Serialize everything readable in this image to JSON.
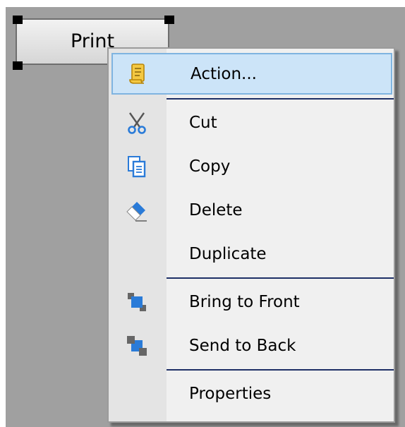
{
  "button": {
    "label": "Print"
  },
  "context_menu": {
    "items": [
      {
        "label": "Action...",
        "icon": "action-icon",
        "highlighted": true
      },
      {
        "label": "Cut",
        "icon": "scissors-icon"
      },
      {
        "label": "Copy",
        "icon": "copy-icon"
      },
      {
        "label": "Delete",
        "icon": "eraser-icon"
      },
      {
        "label": "Duplicate",
        "icon": ""
      },
      {
        "label": "Bring to Front",
        "icon": "bring-to-front-icon"
      },
      {
        "label": "Send to Back",
        "icon": "send-to-back-icon"
      },
      {
        "label": "Properties",
        "icon": ""
      }
    ]
  },
  "colors": {
    "canvas": "#a0a0a0",
    "menu_background": "#f0f0f0",
    "highlight": "#cce4f8",
    "highlight_border": "#7fb4e0",
    "separator": "#1e2f66",
    "icon_blue": "#2a7bd8"
  }
}
